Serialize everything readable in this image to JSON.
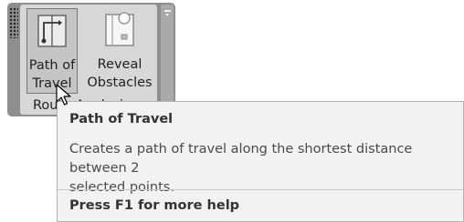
{
  "ribbon": {
    "tools": [
      {
        "label": "Path of\nTravel",
        "icon": "path-of-travel-icon",
        "active": true
      },
      {
        "label": "Reveal\nObstacles",
        "icon": "reveal-obstacles-icon",
        "active": false
      }
    ],
    "panel_title": "Route Analysis"
  },
  "tooltip": {
    "title": "Path of Travel",
    "description": "Creates a path of travel along the shortest distance between 2\nselected points.",
    "help": "Press F1 for more help"
  },
  "colors": {
    "panel_frame": "#8e8e8e",
    "panel_body": "#d7d7d7",
    "tooltip_bg": "#f2f2f2"
  }
}
